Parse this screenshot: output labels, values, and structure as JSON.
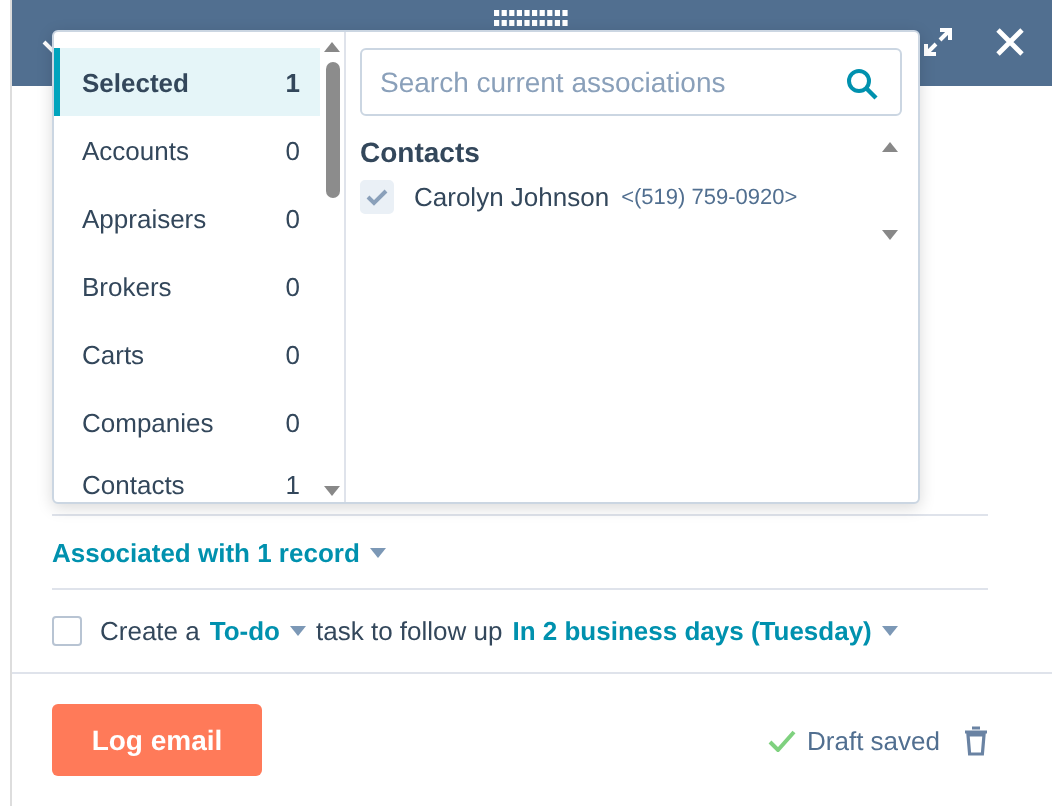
{
  "association_popover": {
    "categories": [
      {
        "label": "Selected",
        "count": "1",
        "selected": true
      },
      {
        "label": "Accounts",
        "count": "0",
        "selected": false
      },
      {
        "label": "Appraisers",
        "count": "0",
        "selected": false
      },
      {
        "label": "Brokers",
        "count": "0",
        "selected": false
      },
      {
        "label": "Carts",
        "count": "0",
        "selected": false
      },
      {
        "label": "Companies",
        "count": "0",
        "selected": false
      },
      {
        "label": "Contacts",
        "count": "1",
        "selected": false
      }
    ],
    "search": {
      "placeholder": "Search current associations"
    },
    "section_title": "Contacts",
    "records": [
      {
        "name": "Carolyn Johnson",
        "phone": "<(519) 759-0920>",
        "checked": true
      }
    ]
  },
  "associated_link": "Associated with 1 record",
  "task": {
    "checked": false,
    "prefix": "Create a",
    "task_type": "To-do",
    "middle": "task to follow up",
    "due": "In 2 business days (Tuesday)"
  },
  "footer": {
    "button": "Log email",
    "status": "Draft saved"
  }
}
